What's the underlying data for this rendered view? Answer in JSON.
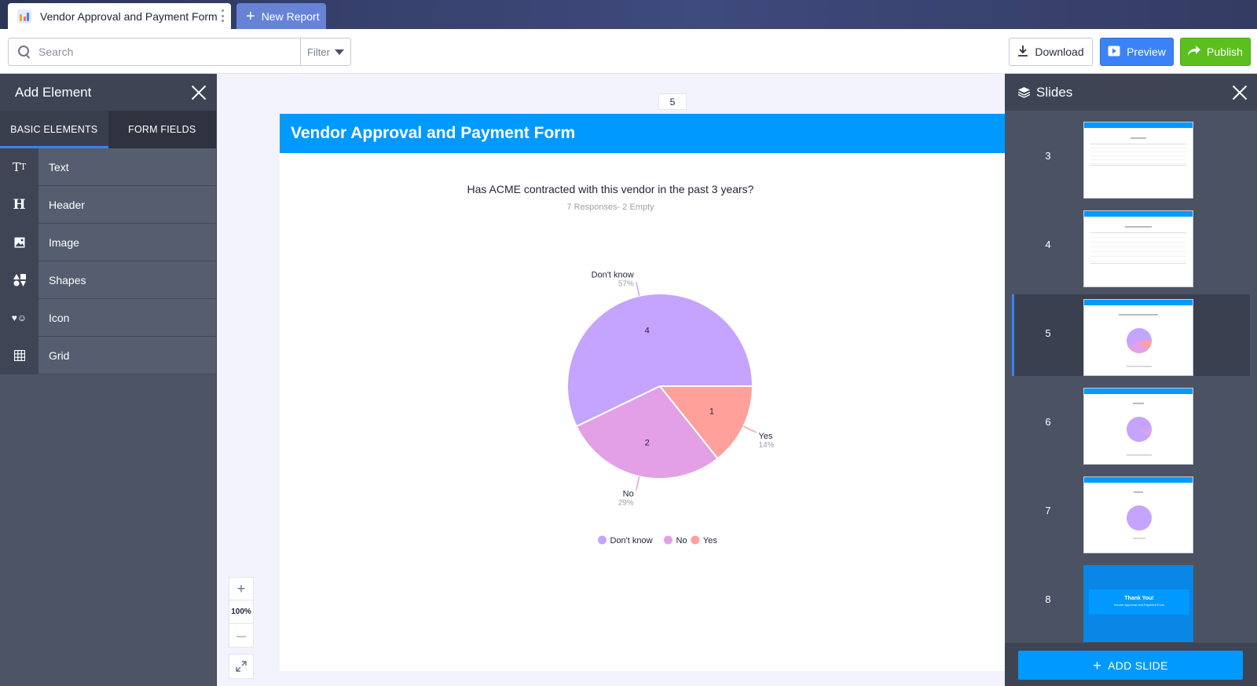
{
  "tabs": {
    "active_title": "Vendor Approval and Payment Form",
    "new_report_label": "New Report"
  },
  "toolbar": {
    "search_placeholder": "Search",
    "filter_label": "Filter",
    "download_label": "Download",
    "preview_label": "Preview",
    "publish_label": "Publish"
  },
  "left_panel": {
    "title": "Add Element",
    "tabs": [
      "BASIC ELEMENTS",
      "FORM FIELDS"
    ],
    "items": [
      {
        "label": "Text",
        "icon": "text-icon",
        "glyph": "Tт"
      },
      {
        "label": "Header",
        "icon": "header-icon",
        "glyph": "H"
      },
      {
        "label": "Image",
        "icon": "image-icon",
        "glyph": "▣"
      },
      {
        "label": "Shapes",
        "icon": "shapes-icon",
        "glyph": "◭"
      },
      {
        "label": "Icon",
        "icon": "heart-smile-icon",
        "glyph": "♥☺"
      },
      {
        "label": "Grid",
        "icon": "grid-icon",
        "glyph": "▦"
      }
    ]
  },
  "canvas": {
    "page_number": "5",
    "slide_title": "Vendor Approval and Payment Form",
    "zoom_in": "+",
    "zoom_level": "100%",
    "zoom_out": "—"
  },
  "chart_data": {
    "type": "pie",
    "title": "Has ACME contracted with this vendor in the past 3 years?",
    "subtitle": "7 Responses- 2 Empty",
    "categories": [
      "Don't know",
      "No",
      "Yes"
    ],
    "values": [
      4,
      2,
      1
    ],
    "percent_labels": [
      "57%",
      "29%",
      "14%"
    ],
    "colors": [
      "#c4a4ff",
      "#e3a0e6",
      "#ffa09a"
    ],
    "legend_position": "bottom-center"
  },
  "right_panel": {
    "title": "Slides",
    "slides": [
      {
        "number": "3"
      },
      {
        "number": "4"
      },
      {
        "number": "5",
        "active": true
      },
      {
        "number": "6"
      },
      {
        "number": "7"
      },
      {
        "number": "8",
        "thanks_title": "Thank You!",
        "thanks_sub": "Vendor Approval and Payment Form"
      }
    ],
    "add_slide_label": "ADD SLIDE"
  },
  "colors": {
    "brand_blue": "#0099ff",
    "preview_blue": "#3b82f6",
    "publish_green": "#5cbf1e",
    "panel_dark": "#4c5466"
  }
}
